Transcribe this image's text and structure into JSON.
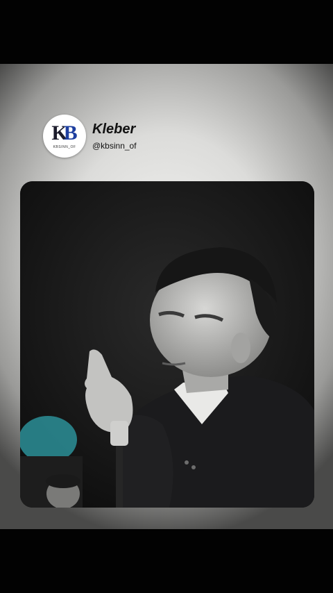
{
  "profile": {
    "display_name": "Kleber",
    "handle": "@kbsinn_of",
    "logo_text": "KB",
    "logo_subtext": "KBSINN_OF"
  },
  "colors": {
    "logo_blue": "#1e3fa0",
    "background_light": "#e6e6e4",
    "bars": "#020202"
  }
}
